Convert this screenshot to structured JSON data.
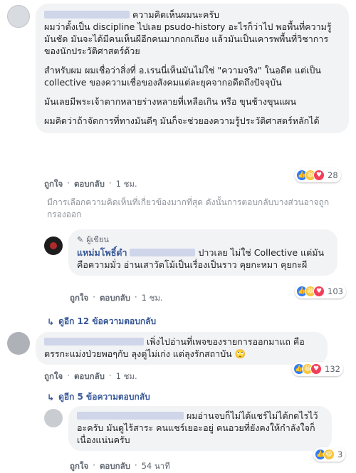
{
  "comment1": {
    "author_suffix": "ความคิดเห็นผมนะครับ",
    "paragraphs": [
      "ผมว่าตั้งเป็น discipline ไปเลย psudo-history อะไรก็ว่าไป พอพื้นที่ความรู้มันชัด มันจะได้มีคนเห็นผีอีกคนมากถกเถียง แล้วมันเป็นเคารพพื้นที่วิชาการของนักประวัติศาสตร์ด้วย",
      "สำหรับผม ผมเชื่อว่าสิ่งที่ อ.เรนนี่เห็นมันไม่ใช่ \"ความจริง\" ในอดีต แต่เป็น collective ของความเชื่อของสังคมแต่ละยุคจากอดีตถึงปัจจุบัน",
      "มันเลยมีพระเจ้าตากหลายร่างหลายที่เหลือเกิน หรือ ขุนช้างขุนแผน",
      "ผมคิดว่าถ้าจัดการที่ทางมันดีๆ มันก็จะช่วยองความรู้ประวัติศาสตร์หลักได้"
    ],
    "like": "ถูกใจ",
    "reply": "ตอบกลับ",
    "time": "1 ชม.",
    "reactions": "28"
  },
  "notice": "มีการเลือกความคิดเห็นที่เกี่ยวข้องมากที่สุด ดังนั้นการตอบกลับบางส่วนอาจถูกกรองออก",
  "reply1": {
    "badge": "ผู้เขียน",
    "author": "แหม่มโพธิ์ดำ",
    "text": "ปาวเลย ไม่ใช่ Collective แต่มันคือความมั่ว อ่านเสาวัดโม้เป็นเรื่องเป็นราว คุยกะหมา คุยกะผี",
    "like": "ถูกใจ",
    "reply": "ตอบกลับ",
    "time": "1 ชม.",
    "reactions": "103"
  },
  "toggle1": "ดูอีก 12 ข้อความตอบกลับ",
  "comment2": {
    "text": "เพิ่งไปอ่านที่เพจของรายการออกมาแถ คือตรรกะแม่งป่วยพอๆกับ ลุงตู่ไม่เก่ง แต่ลุงรักสถาบัน 🙄",
    "like": "ถูกใจ",
    "reply": "ตอบกลับ",
    "time": "1 ชม.",
    "reactions": "132"
  },
  "toggle2": "ดูอีก 5 ข้อความตอบกลับ",
  "reply2": {
    "text": "ผมอ่านจบก็ไม่ได้แชร์ไม่ได้กดไรไว้อะครับ มันดูไร้สาระ คนแชร์เยอะอยู่ คนอวยที่ยังคงให้กำลังใจก็เนื่องแน่นครับ",
    "like": "ถูกใจ",
    "reply": "ตอบกลับ",
    "time": "54 นาที",
    "reactions": "3"
  },
  "colors": {
    "link": "#385898",
    "bubble": "#f2f3f5",
    "like": "#2f7cf6"
  }
}
